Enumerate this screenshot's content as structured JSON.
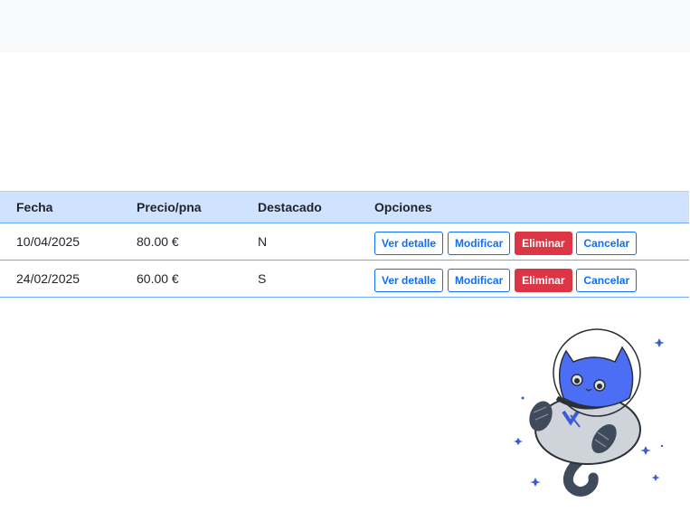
{
  "table": {
    "headers": [
      "Fecha",
      "Precio/pna",
      "Destacado",
      "Opciones"
    ],
    "rows": [
      {
        "fecha": "10/04/2025",
        "precio": "80.00 €",
        "destacado": "N"
      },
      {
        "fecha": "24/02/2025",
        "precio": "60.00 €",
        "destacado": "S"
      }
    ],
    "actions": {
      "ver": "Ver detalle",
      "modificar": "Modificar",
      "eliminar": "Eliminar",
      "cancelar": "Cancelar"
    }
  },
  "colors": {
    "header_bg": "#cfe2ff",
    "primary": "#0d6efd",
    "danger": "#dc3545"
  },
  "mascot": {
    "icon": "astronaut-cat-illustration"
  }
}
